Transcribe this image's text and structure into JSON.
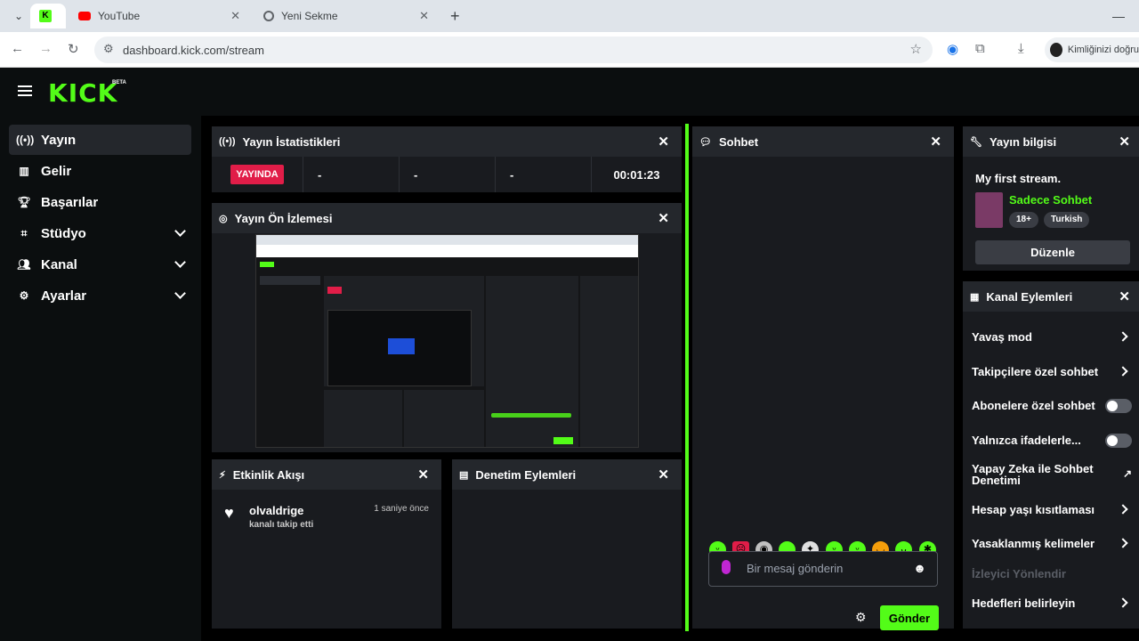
{
  "browser": {
    "tabs": [
      {
        "label": "YouTube"
      },
      {
        "label": "Yeni Sekme"
      }
    ],
    "url": "dashboard.kick.com/stream",
    "profile_label": "Kimliğinizi doğru"
  },
  "app": {
    "logo": "KICK",
    "logo_badge": "BETA"
  },
  "sidebar": {
    "items": [
      {
        "label": "Yayın"
      },
      {
        "label": "Gelir"
      },
      {
        "label": "Başarılar"
      },
      {
        "label": "Stüdyo"
      },
      {
        "label": "Kanal"
      },
      {
        "label": "Ayarlar"
      }
    ]
  },
  "stats": {
    "title": "Yayın İstatistikleri",
    "live_label": "YAYINDA",
    "values": [
      "-",
      "-",
      "-"
    ],
    "duration": "00:01:23"
  },
  "preview": {
    "title": "Yayın Ön İzlemesi"
  },
  "activity": {
    "title": "Etkinlik Akışı",
    "events": [
      {
        "user": "olvaldrige",
        "action": "kanalı takip etti",
        "time": "1 saniye önce"
      }
    ]
  },
  "moderation": {
    "title": "Denetim Eylemleri"
  },
  "chat": {
    "title": "Sohbet",
    "input_placeholder": "Bir mesaj gönderin",
    "send_label": "Gönder"
  },
  "stream_info": {
    "title": "Yayın bilgisi",
    "stream_title": "My first stream.",
    "category": "Sadece Sohbet",
    "tags": [
      "18+",
      "Turkish"
    ],
    "edit_label": "Düzenle"
  },
  "channel_actions": {
    "title": "Kanal Eylemleri",
    "items": [
      {
        "label": "Yavaş mod"
      },
      {
        "label": "Takipçilere özel sohbet"
      },
      {
        "label": "Abonelere özel sohbet"
      },
      {
        "label": "Yalnızca ifadelerle..."
      },
      {
        "label": "Yapay Zeka ile Sohbet Denetimi"
      },
      {
        "label": "Hesap yaşı kısıtlaması"
      },
      {
        "label": "Yasaklanmış kelimeler"
      },
      {
        "label": "İzleyici Yönlendir"
      },
      {
        "label": "Hedefleri belirleyin"
      }
    ]
  },
  "colors": {
    "accent": "#53fc18",
    "live": "#e11d48"
  }
}
